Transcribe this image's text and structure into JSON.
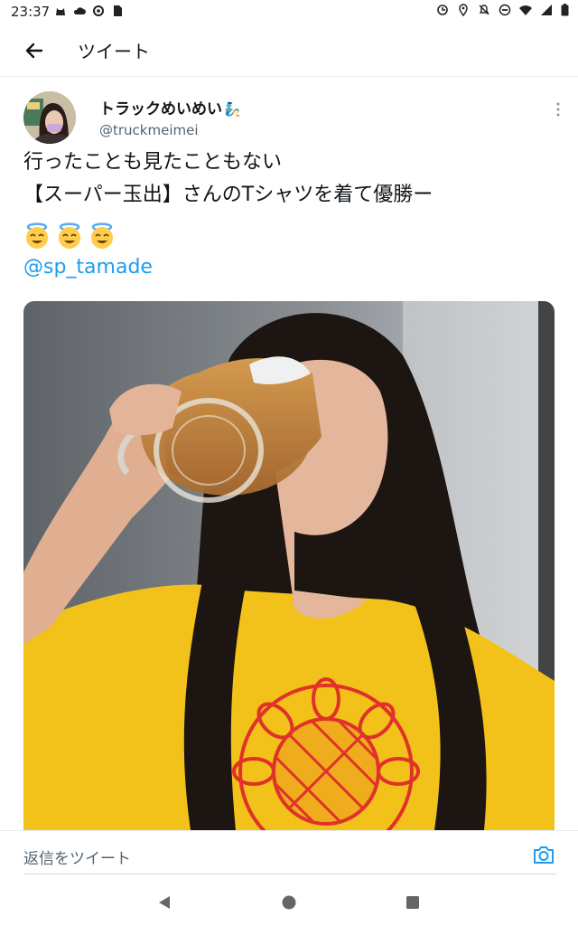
{
  "status_bar": {
    "time": "23:37",
    "left_icons": [
      "cat-icon",
      "cloud-icon",
      "settings-icon",
      "sd-card-icon"
    ],
    "right_icons": [
      "sync-icon",
      "location-icon",
      "alarm-off-icon",
      "do-not-disturb-icon",
      "wifi-icon",
      "signal-icon",
      "battery-icon"
    ]
  },
  "header": {
    "title": "ツイート",
    "back_icon": "arrow-left-icon"
  },
  "tweet": {
    "author_name": "トラックめいめい",
    "author_handle": "@truckmeimei",
    "name_emoji": "🧞",
    "text_lines": [
      "行ったことも見たこともない",
      "【スーパー玉出】さんのTシャツを着て優勝ー"
    ],
    "emojis": [
      "😇",
      "😇",
      "😇"
    ],
    "mention": "@sp_tamade"
  },
  "reply": {
    "placeholder": "返信をツイート",
    "camera_icon": "camera-icon"
  },
  "nav": {
    "buttons": [
      "back-triangle-icon",
      "home-circle-icon",
      "recents-square-icon"
    ]
  },
  "colors": {
    "accent": "#1d9bf0",
    "shirt_yellow": "#f3c21a",
    "sunflower_red": "#e0312a",
    "text": "#0f1419",
    "secondary": "#536471"
  }
}
